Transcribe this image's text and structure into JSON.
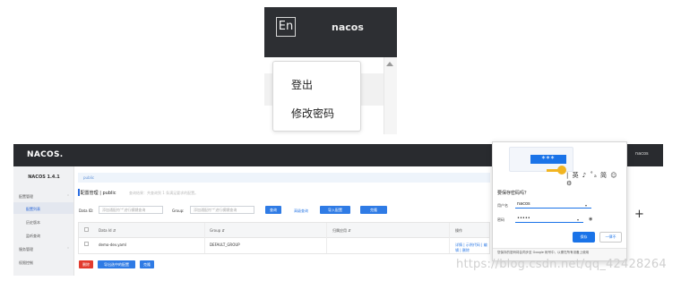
{
  "top": {
    "lang_label": "En",
    "user": "nacos",
    "menu": [
      "登出",
      "修改密码"
    ]
  },
  "header": {
    "logo": "NACOS.",
    "lang_label": "En",
    "user": "nacos"
  },
  "sidebar": {
    "title": "NACOS 1.4.1",
    "items": [
      "配置管理",
      "配置列表",
      "历史版本",
      "监听查询",
      "服务管理",
      "权限控制"
    ]
  },
  "namespace": {
    "label": "public"
  },
  "breadcrumb": {
    "title": "配置管理",
    "sep": "|",
    "namespace": "public",
    "hint": "查询结果：共查询到 1 条满足要求的配置。"
  },
  "filters": {
    "data_id_label": "Data ID:",
    "data_id_placeholder": "添加通配符'*'进行模糊查询",
    "group_label": "Group:",
    "group_placeholder": "添加通配符'*'进行模糊查询",
    "query_button": "查询",
    "advanced_link": "高级查询",
    "import_button": "导入配置",
    "clone_button": "克隆"
  },
  "table": {
    "headers": [
      "Data Id ⇵",
      "Group ⇵",
      "归属应用 ⇵",
      "操作"
    ],
    "rows": [
      {
        "data_id": "demo-dev.yaml",
        "group": "DEFAULT_GROUP",
        "app": "",
        "ops": "详情 | 示例代码 | 编辑 | 删除"
      }
    ]
  },
  "bottom_buttons": {
    "delete": "删除",
    "export_selected": "导出选中的配置",
    "clone": "克隆"
  },
  "password_popup": {
    "stars": "***",
    "toolbar": "| 英 ♪ ˚ₐ 简 ☺ ⚙",
    "title": "要保存密码吗？",
    "username_label": "用户名",
    "username_value": "nacos",
    "password_label": "密码",
    "password_value": "•••••",
    "save_button": "保存",
    "never_button": "一律不",
    "footer": "您保存的密码将会同步至 Google 帐号中，以便在所有设备上使用"
  },
  "watermark": "https://blog.csdn.net/qq_42428264"
}
